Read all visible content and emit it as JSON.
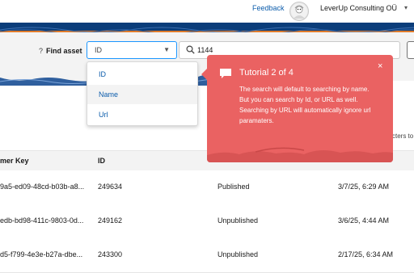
{
  "header": {
    "feedback": "Feedback",
    "org": "LeverUp Consulting OÜ"
  },
  "find": {
    "help": "?",
    "label": "Find asset",
    "selected": "ID",
    "query": "1144",
    "options": [
      "ID",
      "Name",
      "Url"
    ]
  },
  "hint": "cters to",
  "table": {
    "columns": [
      "mer Key",
      "ID"
    ],
    "rows": [
      {
        "key": "9a5-ed09-48cd-b03b-a8...",
        "id": "249634",
        "status": "Published",
        "date": "3/7/25, 6:29 AM"
      },
      {
        "key": "edb-bd98-411c-9803-0d...",
        "id": "249162",
        "status": "Unpublished",
        "date": "3/6/25, 4:44 AM"
      },
      {
        "key": "d5-f799-4e3e-b27a-dbe...",
        "id": "243300",
        "status": "Unpublished",
        "date": "2/17/25, 6:34 AM"
      }
    ]
  },
  "tutorial": {
    "title": "Tutorial 2 of 4",
    "text": "The search will default to searching by name. But you can search by Id, or URL as well. Searching by URL will automatically ignore url paramaters.",
    "close": "×"
  },
  "colors": {
    "brand_band": "#0b3d7a",
    "accent": "#e07b2a",
    "popover": "#ea6262",
    "link": "#0b5cab"
  }
}
